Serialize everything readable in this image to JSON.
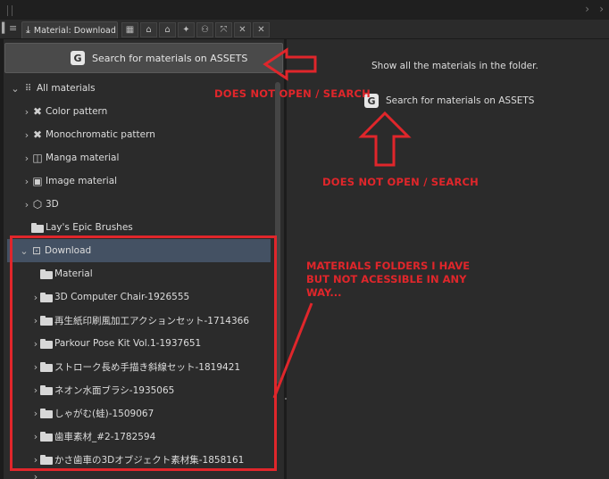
{
  "toolbar": {
    "tab_label": "Material: Download",
    "icons": [
      "grid-icon",
      "lock-icon",
      "figure-icon",
      "person-icon",
      "network-icon",
      "expand-icon",
      "close-icon",
      "collapse-icon"
    ]
  },
  "left": {
    "search_button_label": "Search for materials on ASSETS",
    "tree": [
      {
        "label": "All materials",
        "icon": "grid-dots-icon"
      },
      {
        "label": "Color pattern",
        "icon": "x-pattern-icon"
      },
      {
        "label": "Monochromatic pattern",
        "icon": "x-bold-icon"
      },
      {
        "label": "Manga material",
        "icon": "manga-icon"
      },
      {
        "label": "Image material",
        "icon": "image-icon"
      },
      {
        "label": "3D",
        "icon": "cube-icon"
      },
      {
        "label": "Lay's Epic Brushes",
        "icon": "folder-icon"
      },
      {
        "label": "Download",
        "icon": "download-folder-icon"
      },
      {
        "label": "Material",
        "icon": "folder-icon"
      },
      {
        "label": "3D Computer Chair-1926555",
        "icon": "folder-icon"
      },
      {
        "label": "再生紙印刷風加工アクションセット-1714366",
        "icon": "folder-icon"
      },
      {
        "label": "Parkour Pose Kit Vol.1-1937651",
        "icon": "folder-icon"
      },
      {
        "label": "ストローク長め手描き斜線セット-1819421",
        "icon": "folder-icon"
      },
      {
        "label": "ネオン水面ブラシ-1935065",
        "icon": "folder-icon"
      },
      {
        "label": "しゃがむ(蛙)-1509067",
        "icon": "folder-icon"
      },
      {
        "label": "歯車素材_#2-1782594",
        "icon": "folder-icon"
      },
      {
        "label": "かさ歯車の3Dオブジェクト素材集-1858161",
        "icon": "folder-icon"
      }
    ]
  },
  "right": {
    "message": "Show all the materials in the folder.",
    "search_link": "Search for materials on ASSETS"
  },
  "annotations": {
    "arrow_note_1": "DOES NOT OPEN / SEARCH",
    "arrow_note_2": "DOES NOT OPEN / SEARCH",
    "box_note": "MATERIALS FOLDERS I HAVE\nBUT NOT ACESSIBLE IN ANY\nWAY..."
  },
  "colors": {
    "annotation_red": "#e0262b",
    "selected_row": "#445163"
  }
}
